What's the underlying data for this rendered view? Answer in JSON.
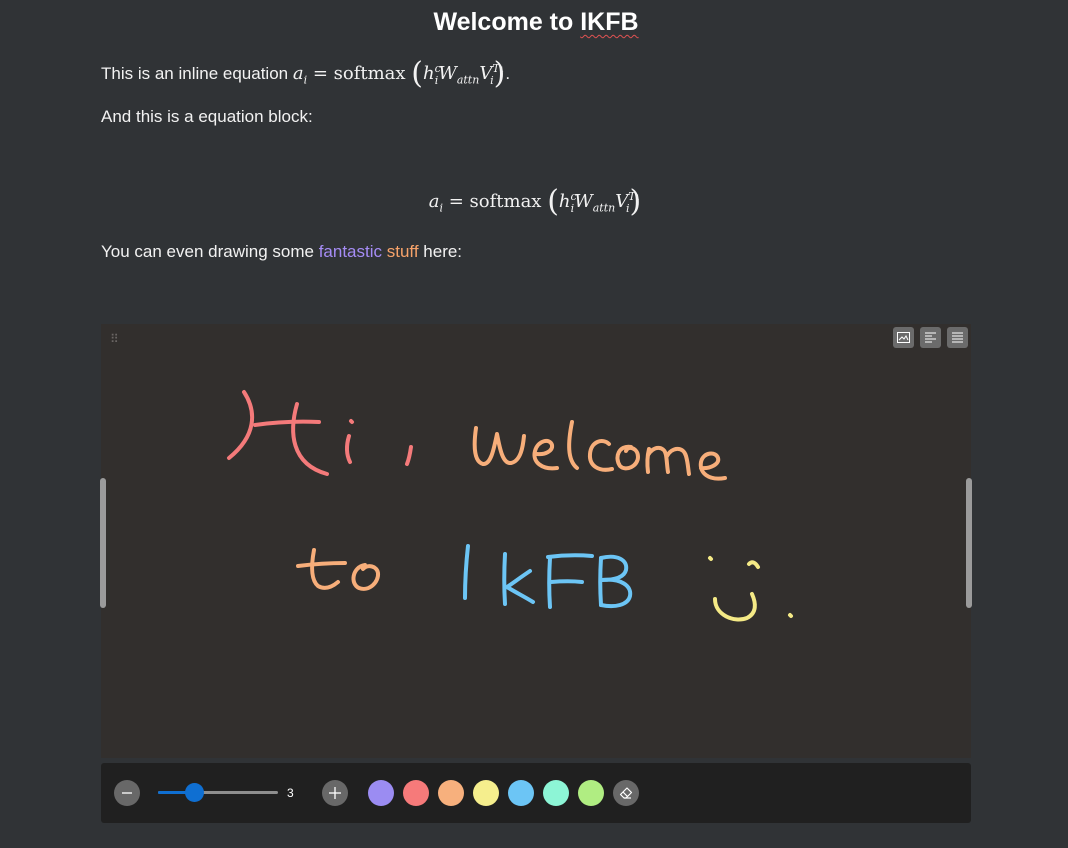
{
  "document": {
    "title_prefix": "Welcome to ",
    "title_spell": "IKFB",
    "inline_intro": "This is an inline equation ",
    "inline_end": ".",
    "block_intro": "And this is a equation block:",
    "equation": {
      "lhs_var": "a",
      "lhs_sub": "i",
      "equals": " = ",
      "func": "softmax",
      "h": "h",
      "h_sub": "i",
      "h_sup": "c",
      "W": "W",
      "W_sub": "attn",
      "V": "V",
      "V_sub": "i",
      "V_sup": "T",
      "V_sup2": "1",
      "lparen": "(",
      "rparen": ")"
    },
    "drawing_intro_1": "You can even drawing some ",
    "drawing_word_1": "fantastic",
    "drawing_space": " ",
    "drawing_word_2": "stuff",
    "drawing_intro_2": " here:"
  },
  "canvas": {
    "handwriting": [
      "Hi, Welcome",
      "to IKFB"
    ],
    "drag_handle_glyph": "⠿",
    "tools": [
      "image-icon",
      "align-left-icon",
      "align-justify-icon"
    ]
  },
  "toolbar": {
    "minus_icon": "minus-icon",
    "plus_icon": "plus-icon",
    "eraser_icon": "eraser-icon",
    "brush_size": "3",
    "brush_min": 1,
    "brush_max": 10,
    "colors": [
      "#9b8cf2",
      "#f67a7a",
      "#f7b07d",
      "#f5ee8d",
      "#6cc5f5",
      "#8df5d6",
      "#b0ed82"
    ]
  },
  "colors": {
    "text_purple": "#a58cf5",
    "text_orange": "#f7a36a",
    "accent_blue": "#0f6fd2",
    "background": "#303336",
    "canvas_bg": "#322f2d"
  }
}
